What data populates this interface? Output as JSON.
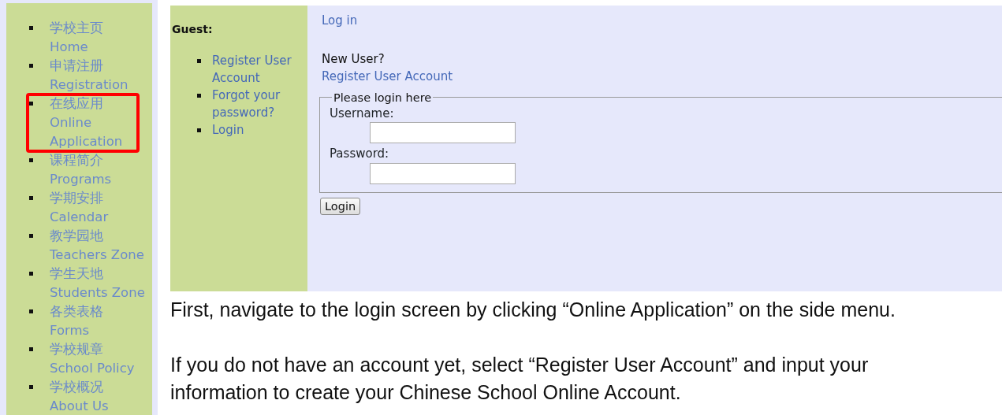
{
  "side_menu": {
    "items": [
      {
        "chinese": "学校主页",
        "english": "Home",
        "highlighted": false
      },
      {
        "chinese": "申请注册",
        "english": "Registration",
        "highlighted": false
      },
      {
        "chinese": "在线应用",
        "english": "Online Application",
        "highlighted": true
      },
      {
        "chinese": "课程简介",
        "english": "Programs",
        "highlighted": false
      },
      {
        "chinese": "学期安排",
        "english": "Calendar",
        "highlighted": false
      },
      {
        "chinese": "教学园地",
        "english": "Teachers Zone",
        "highlighted": false
      },
      {
        "chinese": "学生天地",
        "english": "Students Zone",
        "highlighted": false
      },
      {
        "chinese": "各类表格",
        "english": "Forms",
        "highlighted": false
      },
      {
        "chinese": "学校规章",
        "english": "School Policy",
        "highlighted": false
      },
      {
        "chinese": "学校概况",
        "english": "About Us",
        "highlighted": false
      }
    ]
  },
  "login_page": {
    "guest_title": "Guest:",
    "guest_links": [
      "Register User Account",
      "Forgot your password?",
      "Login"
    ],
    "heading": "Log in",
    "new_user": "New User?",
    "register_link": "Register User Account",
    "fieldset_legend": "Please login here",
    "username_label": "Username:",
    "password_label": "Password:",
    "login_button": "Login"
  },
  "instructions": [
    "First, navigate to the login screen by clicking “Online Application” on the side menu.",
    "If you do not have an account yet, select “Register User Account” and input your information to create your Chinese School Online Account."
  ]
}
